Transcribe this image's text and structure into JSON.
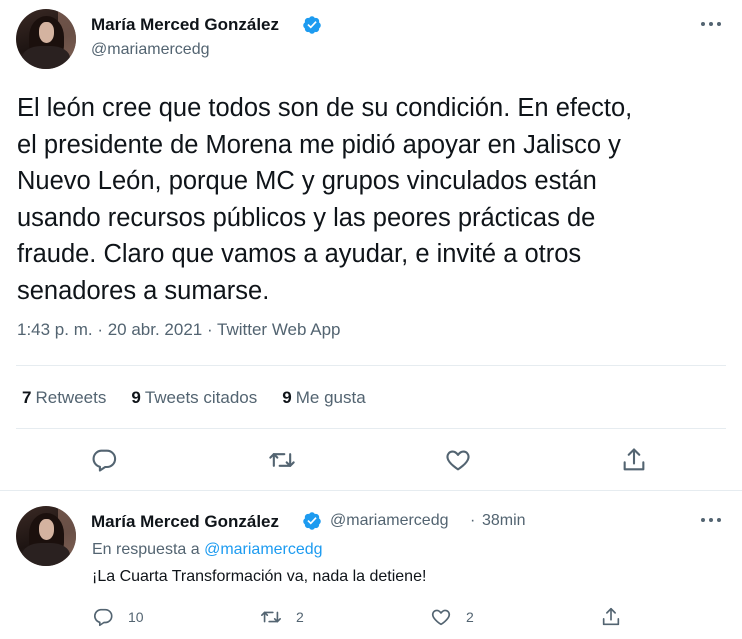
{
  "main_tweet": {
    "author_name": "María Merced González",
    "author_handle": "@mariamercedg",
    "text": "El león cree que todos son de su condición. En efecto,\nel presidente de Morena me pidió apoyar en Jalisco y\nNuevo León, porque MC y  grupos vinculados están\nusando recursos públicos y las peores prácticas de\nfraude. Claro que vamos a ayudar, e invité a otros\nsenadores a sumarse.",
    "meta": "1:43 p. m. · 20 abr. 2021 · Twitter Web App",
    "stats": {
      "retweets_count": "7",
      "retweets_label": "Retweets",
      "quotes_count": "9",
      "quotes_label": "Tweets citados",
      "likes_count": "9",
      "likes_label": "Me gusta"
    }
  },
  "reply_tweet": {
    "author_name": "María Merced González",
    "author_handle": "@mariamercedg",
    "separator": "·",
    "time": "38min",
    "reply_prefix": "En respuesta a",
    "reply_handle": "@mariamercedg",
    "text": "¡La Cuarta Transformación va, nada la detiene!",
    "replies_count": "10",
    "retweets_count": "2",
    "likes_count": "2"
  },
  "colors": {
    "accent": "#1d9bf0",
    "text_primary": "#0f1419",
    "text_secondary": "#536471",
    "divider": "#e6ecf0"
  },
  "icons": [
    "verified-icon",
    "more-icon",
    "reply-icon",
    "retweet-icon",
    "like-icon",
    "share-icon"
  ]
}
